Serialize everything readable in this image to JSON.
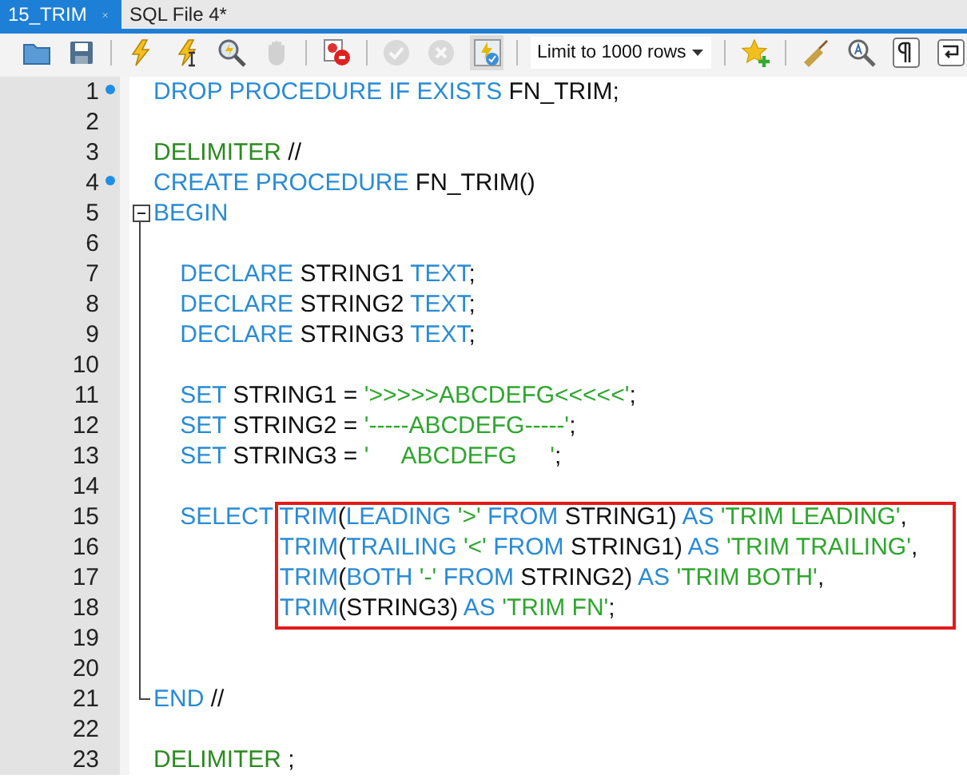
{
  "tabs": [
    {
      "label": "15_TRIM",
      "selected": true,
      "closable": true
    },
    {
      "label": "SQL File 4*",
      "selected": false,
      "closable": false
    }
  ],
  "toolbar": [
    {
      "kind": "open",
      "disabled": false
    },
    {
      "kind": "save",
      "disabled": false
    },
    {
      "kind": "sep"
    },
    {
      "kind": "execute",
      "disabled": false
    },
    {
      "kind": "execute-current",
      "disabled": false
    },
    {
      "kind": "explain",
      "disabled": false
    },
    {
      "kind": "stop",
      "disabled": true
    },
    {
      "kind": "sep"
    },
    {
      "kind": "error-stop",
      "disabled": false
    },
    {
      "kind": "sep"
    },
    {
      "kind": "commit",
      "disabled": true
    },
    {
      "kind": "rollback",
      "disabled": true
    },
    {
      "kind": "autocommit",
      "disabled": false,
      "pressed": true
    },
    {
      "kind": "sep"
    },
    {
      "kind": "limit",
      "value": "Limit to 1000 rows"
    },
    {
      "kind": "sep"
    },
    {
      "kind": "snippet",
      "disabled": false
    },
    {
      "kind": "sep"
    },
    {
      "kind": "beautify",
      "disabled": false
    },
    {
      "kind": "find",
      "disabled": false
    },
    {
      "kind": "invisibles",
      "disabled": false
    },
    {
      "kind": "wrap",
      "disabled": false
    }
  ],
  "lines": [
    {
      "number": "1",
      "marker": true,
      "kind": "plain",
      "boxed": false,
      "tokens": [
        {
          "kind": "kw",
          "text": "DROP PROCEDURE IF EXISTS "
        },
        {
          "kind": "id",
          "text": "FN_TRIM;"
        }
      ]
    },
    {
      "number": "2",
      "marker": false,
      "kind": "plain",
      "boxed": false
    },
    {
      "number": "3",
      "marker": false,
      "kind": "plain",
      "boxed": false,
      "tokens": [
        {
          "kind": "delim",
          "text": "DELIMITER"
        },
        {
          "kind": "id",
          "text": " //"
        }
      ]
    },
    {
      "number": "4",
      "marker": true,
      "kind": "plain",
      "boxed": false,
      "tokens": [
        {
          "kind": "kw",
          "text": "CREATE PROCEDURE "
        },
        {
          "kind": "id",
          "text": "FN_TRIM()"
        }
      ]
    },
    {
      "number": "5",
      "marker": false,
      "kind": "begin",
      "boxed": false,
      "tokens": [
        {
          "kind": "kw",
          "text": "BEGIN"
        }
      ]
    },
    {
      "number": "6",
      "marker": false,
      "kind": "plain",
      "boxed": false
    },
    {
      "number": "7",
      "marker": false,
      "kind": "plain",
      "boxed": false,
      "tokens": [
        {
          "kind": "kw",
          "text": "    DECLARE "
        },
        {
          "kind": "id",
          "text": "STRING1 "
        },
        {
          "kind": "kw",
          "text": "TEXT"
        },
        {
          "kind": "id",
          "text": ";"
        }
      ]
    },
    {
      "number": "8",
      "marker": false,
      "kind": "plain",
      "boxed": false,
      "tokens": [
        {
          "kind": "kw",
          "text": "    DECLARE "
        },
        {
          "kind": "id",
          "text": "STRING2 "
        },
        {
          "kind": "kw",
          "text": "TEXT"
        },
        {
          "kind": "id",
          "text": ";"
        }
      ]
    },
    {
      "number": "9",
      "marker": false,
      "kind": "plain",
      "boxed": false,
      "tokens": [
        {
          "kind": "kw",
          "text": "    DECLARE "
        },
        {
          "kind": "id",
          "text": "STRING3 "
        },
        {
          "kind": "kw",
          "text": "TEXT"
        },
        {
          "kind": "id",
          "text": ";"
        }
      ]
    },
    {
      "number": "10",
      "marker": false,
      "kind": "plain",
      "boxed": false
    },
    {
      "number": "11",
      "marker": false,
      "kind": "plain",
      "boxed": false,
      "tokens": [
        {
          "kind": "kw",
          "text": "    SET "
        },
        {
          "kind": "id",
          "text": "STRING1 = "
        },
        {
          "kind": "str",
          "text": "'>>>>>ABCDEFG<<<<<'"
        },
        {
          "kind": "id",
          "text": ";"
        }
      ]
    },
    {
      "number": "12",
      "marker": false,
      "kind": "plain",
      "boxed": false,
      "tokens": [
        {
          "kind": "kw",
          "text": "    SET "
        },
        {
          "kind": "id",
          "text": "STRING2 = "
        },
        {
          "kind": "str",
          "text": "'-----ABCDEFG-----'"
        },
        {
          "kind": "id",
          "text": ";"
        }
      ]
    },
    {
      "number": "13",
      "marker": false,
      "kind": "plain",
      "boxed": false,
      "tokens": [
        {
          "kind": "kw",
          "text": "    SET "
        },
        {
          "kind": "id",
          "text": "STRING3 = "
        },
        {
          "kind": "str",
          "text": "'     ABCDEFG     '"
        },
        {
          "kind": "id",
          "text": ";"
        }
      ]
    },
    {
      "number": "14",
      "marker": false,
      "kind": "plain",
      "boxed": false
    },
    {
      "number": "15",
      "marker": false,
      "kind": "plain",
      "boxed": true,
      "tokens": [
        {
          "kind": "kw",
          "text": "    SELECT TRIM"
        },
        {
          "kind": "id",
          "text": "("
        },
        {
          "kind": "kw",
          "text": "LEADING "
        },
        {
          "kind": "str",
          "text": "'>'"
        },
        {
          "kind": "kw",
          "text": " FROM "
        },
        {
          "kind": "id",
          "text": "STRING1) "
        },
        {
          "kind": "kw",
          "text": "AS "
        },
        {
          "kind": "str",
          "text": "'TRIM LEADING'"
        },
        {
          "kind": "id",
          "text": ","
        }
      ]
    },
    {
      "number": "16",
      "marker": false,
      "kind": "plain",
      "boxed": true,
      "tokens": [
        {
          "kind": "kw",
          "text": "                   TRIM"
        },
        {
          "kind": "id",
          "text": "("
        },
        {
          "kind": "kw",
          "text": "TRAILING "
        },
        {
          "kind": "str",
          "text": "'<'"
        },
        {
          "kind": "kw",
          "text": " FROM "
        },
        {
          "kind": "id",
          "text": "STRING1) "
        },
        {
          "kind": "kw",
          "text": "AS "
        },
        {
          "kind": "str",
          "text": "'TRIM TRAILING'"
        },
        {
          "kind": "id",
          "text": ","
        }
      ]
    },
    {
      "number": "17",
      "marker": false,
      "kind": "plain",
      "boxed": true,
      "tokens": [
        {
          "kind": "kw",
          "text": "                   TRIM"
        },
        {
          "kind": "id",
          "text": "("
        },
        {
          "kind": "kw",
          "text": "BOTH "
        },
        {
          "kind": "str",
          "text": "'-'"
        },
        {
          "kind": "kw",
          "text": " FROM "
        },
        {
          "kind": "id",
          "text": "STRING2) "
        },
        {
          "kind": "kw",
          "text": "AS "
        },
        {
          "kind": "str",
          "text": "'TRIM BOTH'"
        },
        {
          "kind": "id",
          "text": ","
        }
      ]
    },
    {
      "number": "18",
      "marker": false,
      "kind": "plain",
      "boxed": true,
      "tokens": [
        {
          "kind": "kw",
          "text": "                   TRIM"
        },
        {
          "kind": "id",
          "text": "(STRING3) "
        },
        {
          "kind": "kw",
          "text": "AS "
        },
        {
          "kind": "str",
          "text": "'TRIM FN'"
        },
        {
          "kind": "id",
          "text": ";"
        }
      ]
    },
    {
      "number": "19",
      "marker": false,
      "kind": "plain",
      "boxed": false
    },
    {
      "number": "20",
      "marker": false,
      "kind": "plain",
      "boxed": false
    },
    {
      "number": "21",
      "marker": false,
      "kind": "end",
      "boxed": false,
      "tokens": [
        {
          "kind": "kw",
          "text": "END"
        },
        {
          "kind": "id",
          "text": " //"
        }
      ]
    },
    {
      "number": "22",
      "marker": false,
      "kind": "plain",
      "boxed": false
    },
    {
      "number": "23",
      "marker": false,
      "kind": "plain",
      "boxed": false,
      "tokens": [
        {
          "kind": "delim",
          "text": "DELIMITER"
        },
        {
          "kind": "id",
          "text": " ;"
        }
      ]
    }
  ]
}
